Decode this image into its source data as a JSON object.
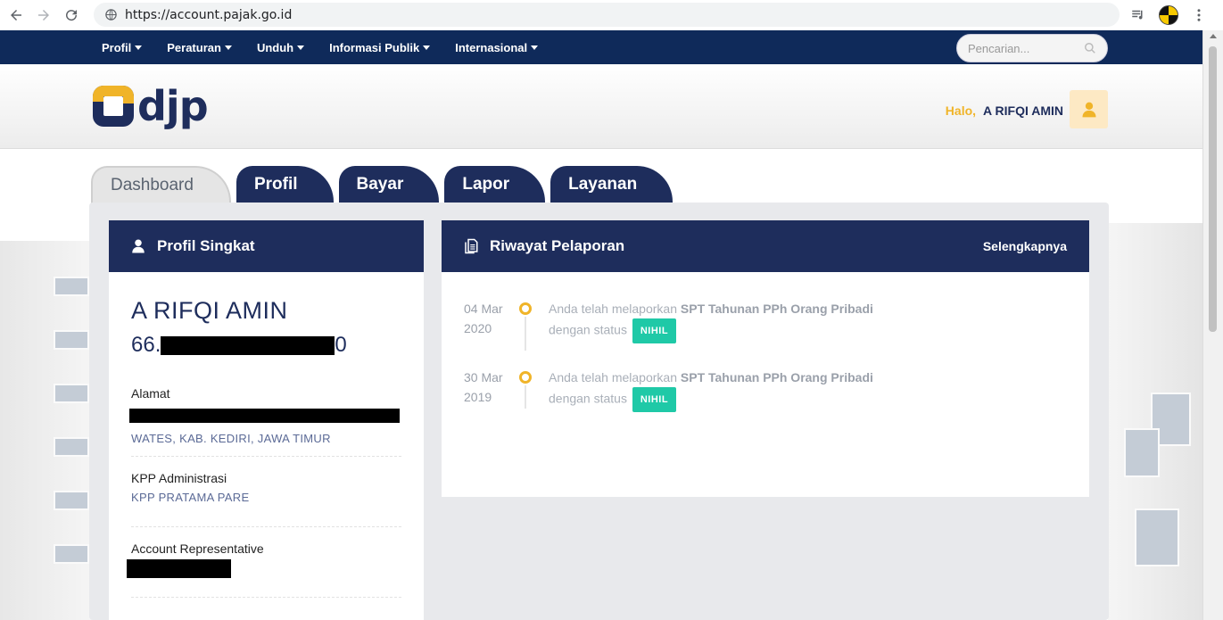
{
  "browser": {
    "url": "https://account.pajak.go.id"
  },
  "topnav": {
    "items": [
      {
        "label": "Profil"
      },
      {
        "label": "Peraturan"
      },
      {
        "label": "Unduh"
      },
      {
        "label": "Informasi Publik"
      },
      {
        "label": "Internasional"
      }
    ],
    "search_placeholder": "Pencarian..."
  },
  "header": {
    "logo_text": "djp",
    "greeting": "Halo,",
    "user_name": "A RIFQI AMIN"
  },
  "tabs": [
    {
      "label": "Dashboard",
      "active": true
    },
    {
      "label": "Profil"
    },
    {
      "label": "Bayar"
    },
    {
      "label": "Lapor"
    },
    {
      "label": "Layanan"
    }
  ],
  "profil": {
    "title": "Profil Singkat",
    "name": "A RIFQI AMIN",
    "npwp_prefix": "66.",
    "npwp_suffix": "0",
    "alamat_label": "Alamat",
    "alamat_value": "WATES, KAB. KEDIRI, JAWA TIMUR",
    "kpp_label": "KPP Administrasi",
    "kpp_value": "KPP PRATAMA PARE",
    "ar_label": "Account Representative"
  },
  "riwayat": {
    "title": "Riwayat Pelaporan",
    "more_label": "Selengkapnya",
    "items": [
      {
        "date_day": "04 Mar",
        "date_year": "2020",
        "text_prefix": "Anda telah melaporkan",
        "form": "SPT Tahunan PPh Orang Pribadi",
        "status_prefix": "dengan status",
        "status": "NIHIL"
      },
      {
        "date_day": "30 Mar",
        "date_year": "2019",
        "text_prefix": "Anda telah melaporkan",
        "form": "SPT Tahunan PPh Orang Pribadi",
        "status_prefix": "dengan status",
        "status": "NIHIL"
      }
    ]
  },
  "colors": {
    "navy": "#1e2d5c",
    "topnav": "#0f2a5a",
    "accent_yellow": "#f0b429",
    "badge_teal": "#1fc9a7"
  }
}
